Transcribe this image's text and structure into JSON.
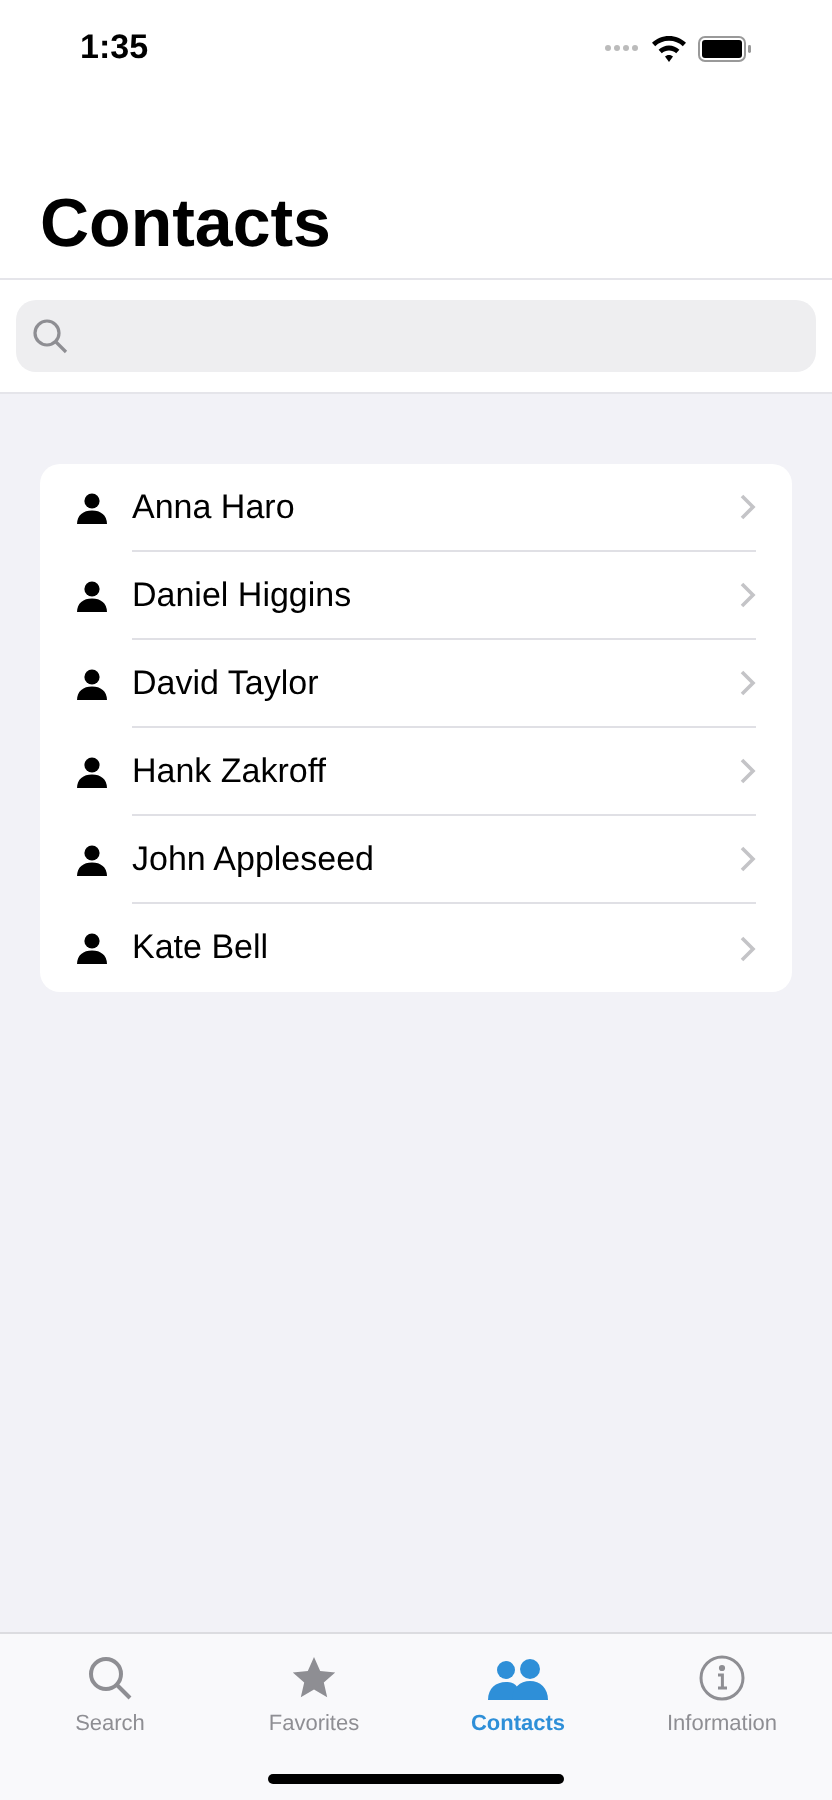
{
  "status_bar": {
    "time": "1:35"
  },
  "title": "Contacts",
  "contacts": [
    {
      "name": "Anna Haro"
    },
    {
      "name": "Daniel Higgins"
    },
    {
      "name": "David Taylor"
    },
    {
      "name": "Hank Zakroff"
    },
    {
      "name": "John Appleseed"
    },
    {
      "name": "Kate Bell"
    }
  ],
  "tabs": [
    {
      "label": "Search",
      "selected": false
    },
    {
      "label": "Favorites",
      "selected": false
    },
    {
      "label": "Contacts",
      "selected": true
    },
    {
      "label": "Information",
      "selected": false
    }
  ]
}
